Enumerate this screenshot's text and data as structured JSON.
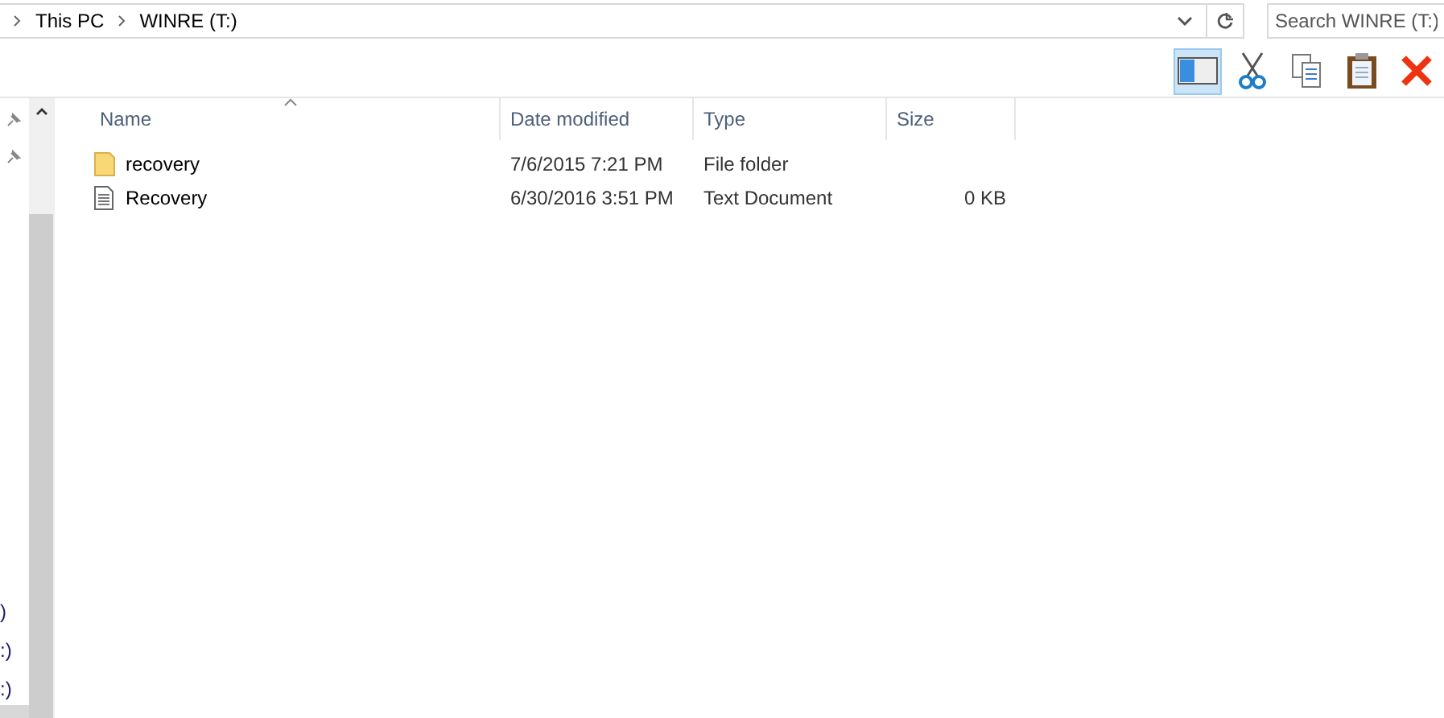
{
  "address_bar": {
    "crumbs": [
      "This PC",
      "WINRE (T:)"
    ]
  },
  "search": {
    "placeholder": "Search WINRE (T:)"
  },
  "toolbar": [
    {
      "kind": "pane",
      "selected": true
    },
    {
      "kind": "cut",
      "selected": false
    },
    {
      "kind": "copy",
      "selected": false
    },
    {
      "kind": "paste",
      "selected": false
    },
    {
      "kind": "delete",
      "selected": false
    }
  ],
  "nav_pane": {
    "items": [
      ")",
      ":)",
      ":)"
    ]
  },
  "table": {
    "columns": [
      "Name",
      "Date modified",
      "Type",
      "Size"
    ],
    "rows": [
      {
        "kind": "folder",
        "name": "recovery",
        "date": "7/6/2015 7:21 PM",
        "type": "File folder",
        "size": ""
      },
      {
        "kind": "text",
        "name": "Recovery",
        "date": "6/30/2016 3:51 PM",
        "type": "Text Document",
        "size": "0 KB"
      }
    ]
  }
}
